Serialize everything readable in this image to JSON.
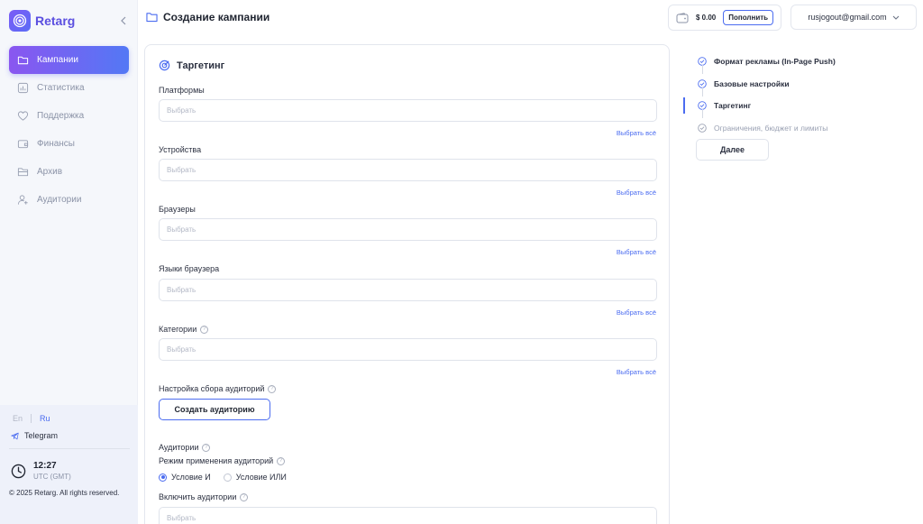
{
  "brand": {
    "name": "Retarg"
  },
  "sidebar": {
    "items": [
      {
        "label": "Кампании",
        "icon": "folder-icon",
        "active": true
      },
      {
        "label": "Статистика",
        "icon": "chart-icon"
      },
      {
        "label": "Поддержка",
        "icon": "heart-icon"
      },
      {
        "label": "Финансы",
        "icon": "wallet-icon"
      },
      {
        "label": "Архив",
        "icon": "archive-icon"
      },
      {
        "label": "Аудитории",
        "icon": "user-add-icon"
      }
    ],
    "lang_en": "En",
    "lang_ru": "Ru",
    "telegram": "Telegram",
    "time": "12:27",
    "timezone": "UTC (GMT)",
    "copyright": "© 2025 Retarg. All rights reserved."
  },
  "header": {
    "title": "Создание кампании",
    "balance": "$ 0.00",
    "topup": "Пополнить",
    "account": "rusjogout@gmail.com"
  },
  "targeting": {
    "title": "Таргетинг",
    "placeholder": "Выбрать",
    "select_all": "Выбрать всё",
    "fields": [
      {
        "label": "Платформы"
      },
      {
        "label": "Устройства"
      },
      {
        "label": "Браузеры"
      },
      {
        "label": "Языки браузера"
      },
      {
        "label": "Категории"
      }
    ],
    "audience_collection_label": "Настройка сбора аудиторий",
    "create_audience": "Создать аудиторию",
    "audiences_label": "Аудитории",
    "mode_label": "Режим применения аудиторий",
    "mode_and": "Условие И",
    "mode_or": "Условие ИЛИ",
    "include_label": "Включить аудитории"
  },
  "steps": {
    "items": [
      {
        "label": "Формат рекламы (In-Page Push)"
      },
      {
        "label": "Базовые настройки"
      },
      {
        "label": "Таргетинг"
      },
      {
        "label": "Ограничения, бюджет и лимиты"
      }
    ],
    "next": "Далее"
  }
}
